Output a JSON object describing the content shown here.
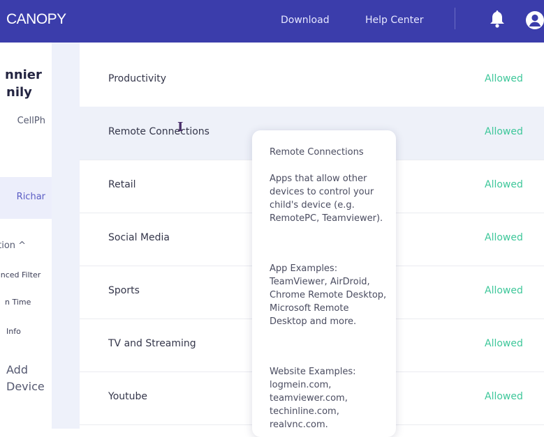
{
  "header": {
    "logo": "CANOPY",
    "download": "Download",
    "help_center": "Help Center",
    "bg_color": "#3b3dab"
  },
  "sidebar": {
    "name_line1": "nnier",
    "name_line2": "nily",
    "device": "CellPh",
    "child": "Richar",
    "section": "ction ^",
    "items": [
      "anced Filter",
      "n Time",
      "Info"
    ],
    "add_device": "Add Device"
  },
  "rows": [
    {
      "label": "Productivity",
      "status": "Allowed"
    },
    {
      "label": "Remote Connections",
      "status": "Allowed"
    },
    {
      "label": "Retail",
      "status": "Allowed"
    },
    {
      "label": "Social Media",
      "status": "Allowed"
    },
    {
      "label": "Sports",
      "status": "Allowed"
    },
    {
      "label": "TV and Streaming",
      "status": "Allowed"
    },
    {
      "label": "Youtube",
      "status": "Allowed"
    }
  ],
  "tooltip": {
    "title": "Remote Connections",
    "description": "Apps that allow other devices to control your child's device (e.g. RemotePC, Teamviewer).",
    "app_examples": "App Examples: TeamViewer, AirDroid, Chrome Remote Desktop, Microsoft Remote Desktop and more.",
    "website_examples": "Website Examples: logmein.com, teamviewer.com, techinline.com, realvnc.com."
  },
  "colors": {
    "accent": "#3b3dab",
    "allowed": "#3ec79a",
    "highlight_row": "#eef1f9"
  }
}
